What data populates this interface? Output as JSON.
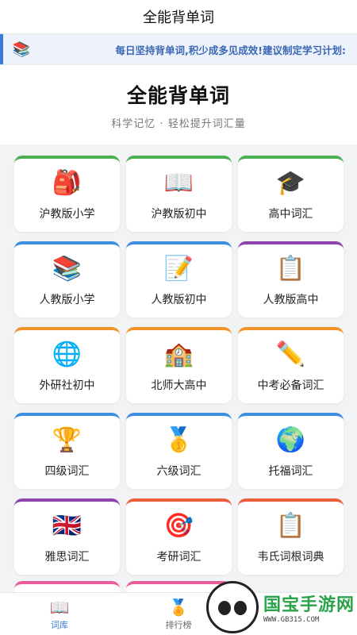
{
  "app": {
    "title": "全能背单词"
  },
  "banner": {
    "icon": "books-icon",
    "text": "每日坚持背单词,积少成多见成效!建议制定学习计划:"
  },
  "hero": {
    "title": "全能背单词",
    "subtitle": "科学记忆 · 轻松提升词汇量"
  },
  "cards": [
    {
      "label": "沪教版小学",
      "icon": "🎒",
      "icon_name": "backpack-icon",
      "accent": "#4caf50"
    },
    {
      "label": "沪教版初中",
      "icon": "📖",
      "icon_name": "open-book-icon",
      "accent": "#4caf50"
    },
    {
      "label": "高中词汇",
      "icon": "🎓",
      "icon_name": "graduation-cap-icon",
      "accent": "#4caf50"
    },
    {
      "label": "人教版小学",
      "icon": "📚",
      "icon_name": "books-icon",
      "accent": "#3b8ee0"
    },
    {
      "label": "人教版初中",
      "icon": "📝",
      "icon_name": "memo-icon",
      "accent": "#3b8ee0"
    },
    {
      "label": "人教版高中",
      "icon": "📋",
      "icon_name": "clipboard-icon",
      "accent": "#8e44ad"
    },
    {
      "label": "外研社初中",
      "icon": "🌐",
      "icon_name": "globe-icon",
      "accent": "#f0932b"
    },
    {
      "label": "北师大高中",
      "icon": "🏫",
      "icon_name": "school-icon",
      "accent": "#f0932b"
    },
    {
      "label": "中考必备词汇",
      "icon": "✏️",
      "icon_name": "pencil-icon",
      "accent": "#f0932b"
    },
    {
      "label": "四级词汇",
      "icon": "🏆",
      "icon_name": "trophy-icon",
      "accent": "#3b8ee0"
    },
    {
      "label": "六级词汇",
      "icon": "🥇",
      "icon_name": "medal-icon",
      "accent": "#3b8ee0"
    },
    {
      "label": "托福词汇",
      "icon": "🌍",
      "icon_name": "earth-icon",
      "accent": "#3b8ee0"
    },
    {
      "label": "雅思词汇",
      "icon": "🇬🇧",
      "icon_name": "uk-flag-icon",
      "accent": "#8e44ad"
    },
    {
      "label": "考研词汇",
      "icon": "🎯",
      "icon_name": "target-icon",
      "accent": "#e85d3a"
    },
    {
      "label": "韦氏词根词典",
      "icon": "📋",
      "icon_name": "clipboard-icon",
      "accent": "#e85d3a"
    }
  ],
  "tabs": [
    {
      "label": "词库",
      "icon": "📖",
      "icon_name": "book-icon",
      "active": true
    },
    {
      "label": "排行榜",
      "icon": "🏅",
      "icon_name": "podium-icon",
      "active": false
    }
  ],
  "watermark": {
    "main": "国宝手游网",
    "sub": "WWW.GB315.COM"
  }
}
